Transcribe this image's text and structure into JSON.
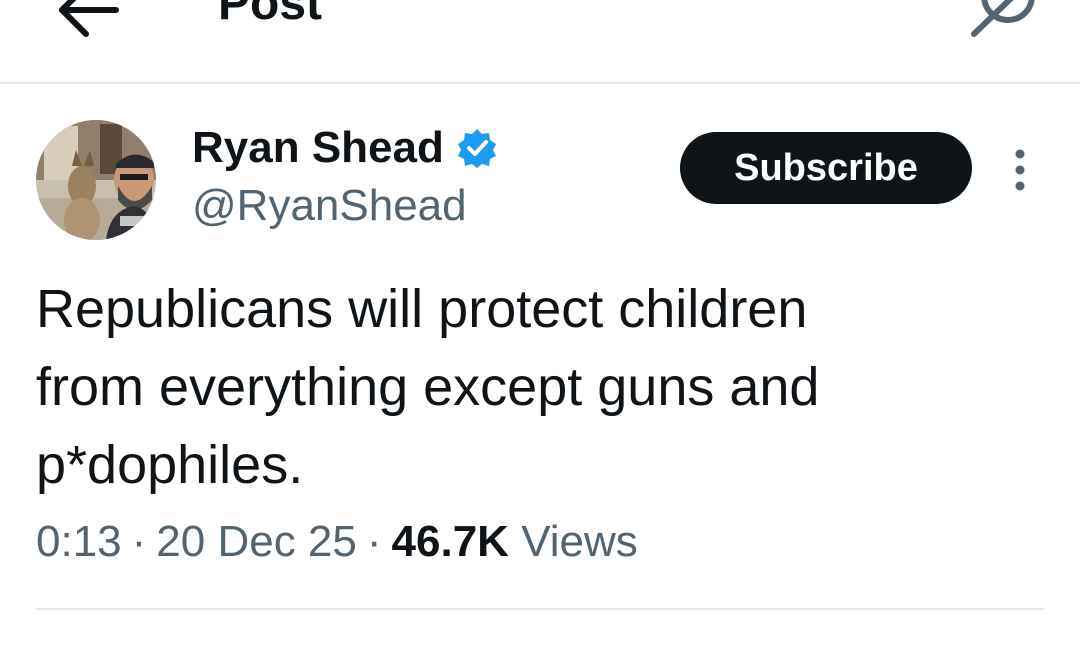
{
  "header": {
    "title": "Post",
    "back_icon": "arrow-left-icon",
    "grok_icon": "grok-icon"
  },
  "author": {
    "name": "Ryan Shead",
    "handle": "@RyanShead",
    "verified": true,
    "verified_color": "#1d9bf0"
  },
  "subscribe_label": "Subscribe",
  "more_icon": "more-vertical-icon",
  "tweet": {
    "lines": [
      "Republicans will protect children",
      "from everything except guns and",
      "p*dophiles."
    ]
  },
  "meta": {
    "time": "0:13",
    "separator": "·",
    "date": "20 Dec 25",
    "views_count": "46.7K",
    "views_label": "Views"
  },
  "colors": {
    "text_primary": "#0f1419",
    "text_secondary": "#536471",
    "accent": "#1d9bf0",
    "divider": "#e7e9ea"
  }
}
